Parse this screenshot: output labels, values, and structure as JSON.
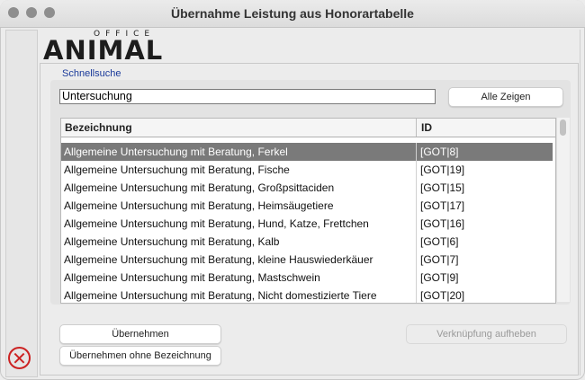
{
  "window": {
    "title": "Übernahme Leistung aus Honorartabelle"
  },
  "logo": {
    "office": "OFFICE",
    "animal": "ANIMAL"
  },
  "search": {
    "label": "Schnellsuche",
    "value": "Untersuchung",
    "show_all": "Alle Zeigen"
  },
  "table": {
    "columns": [
      "Bezeichnung",
      "ID"
    ],
    "rows": [
      {
        "name": "Allgemeine Untersuchung mit Beratung, Ferkel",
        "id": "[GOT|8]",
        "selected": true
      },
      {
        "name": "Allgemeine Untersuchung mit Beratung, Fische",
        "id": "[GOT|19]"
      },
      {
        "name": "Allgemeine Untersuchung mit Beratung, Großpsittaciden",
        "id": "[GOT|15]"
      },
      {
        "name": "Allgemeine Untersuchung mit Beratung, Heimsäugetiere",
        "id": "[GOT|17]"
      },
      {
        "name": "Allgemeine Untersuchung mit Beratung, Hund, Katze, Frettchen",
        "id": "[GOT|16]"
      },
      {
        "name": "Allgemeine Untersuchung mit Beratung, Kalb",
        "id": "[GOT|6]"
      },
      {
        "name": "Allgemeine Untersuchung mit Beratung, kleine Hauswiederkäuer",
        "id": "[GOT|7]"
      },
      {
        "name": "Allgemeine Untersuchung mit Beratung, Mastschwein",
        "id": "[GOT|9]"
      },
      {
        "name": "Allgemeine Untersuchung mit Beratung, Nicht domestizierte Tiere",
        "id": "[GOT|20]"
      }
    ]
  },
  "buttons": {
    "apply": "Übernehmen",
    "apply_without_name": "Übernehmen ohne Bezeichnung",
    "unlink": "Verknüpfung aufheben"
  },
  "icons": {
    "close": "close-icon"
  },
  "colors": {
    "selected_row": "#7a7a7a",
    "label_blue": "#1a3a9a",
    "close_red": "#cc2222"
  }
}
